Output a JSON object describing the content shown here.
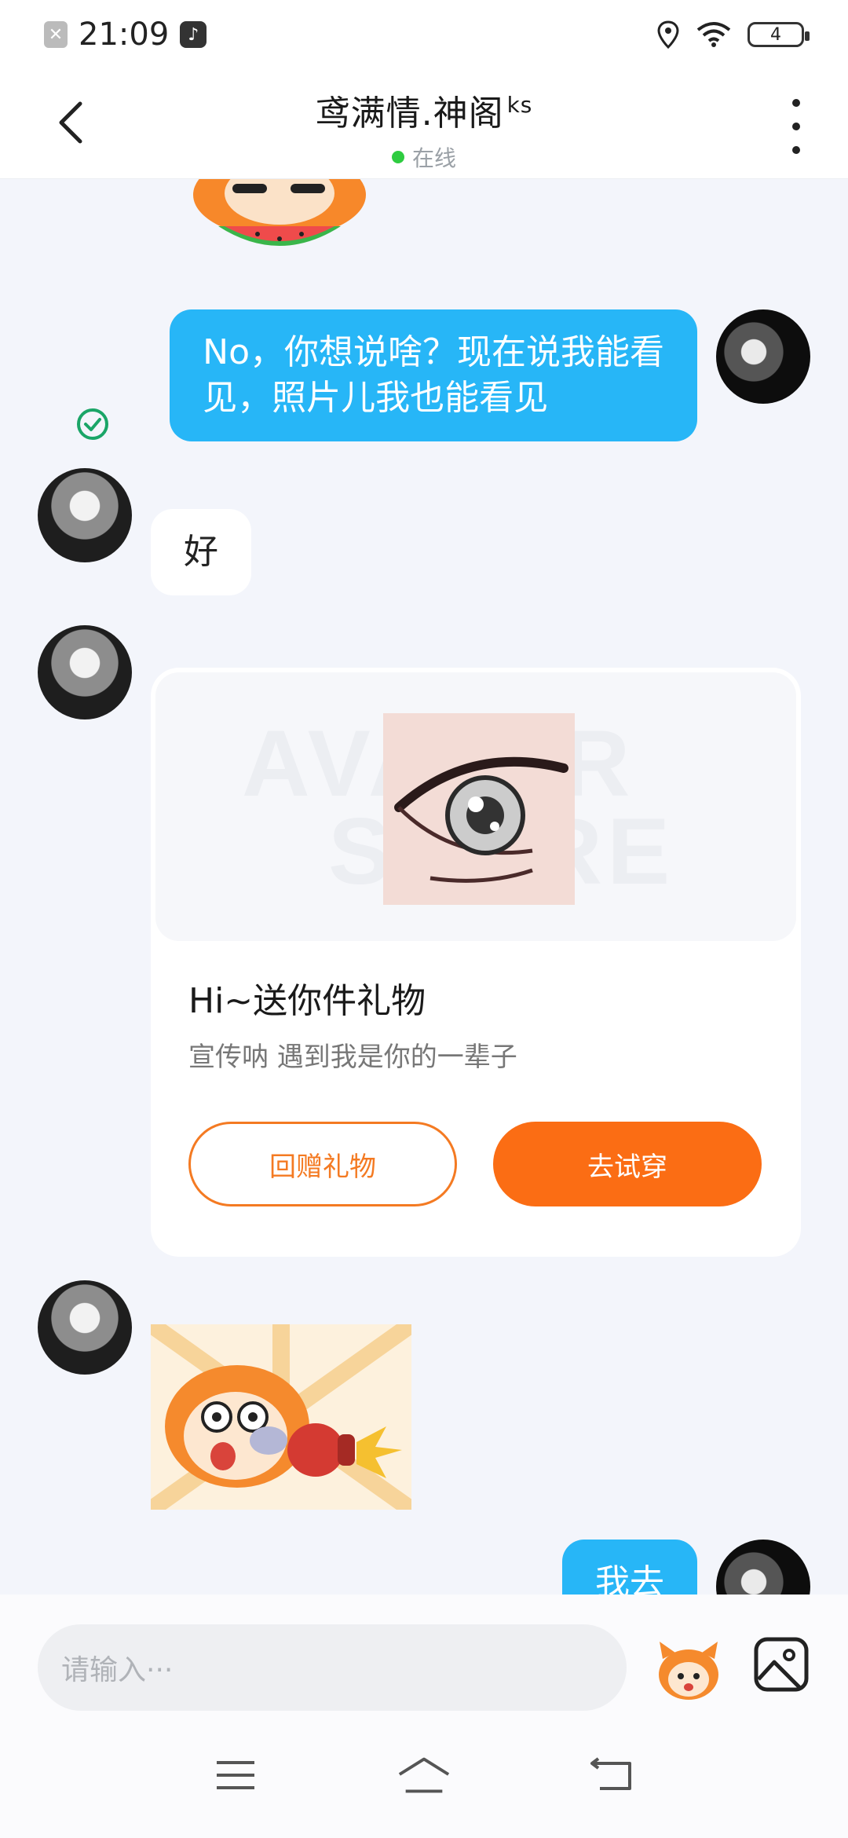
{
  "status_bar": {
    "time": "21:09",
    "battery": "4",
    "icons": [
      "notification-chip-icon",
      "tiktok-icon",
      "location-icon",
      "wifi-icon",
      "battery-icon"
    ]
  },
  "header": {
    "title": "鸢满情.神阁",
    "title_suffix": "ks",
    "status": "在线",
    "status_color": "#2ecc40"
  },
  "messages": [
    {
      "side": "right",
      "text_line1": "No，你想说啥？现在说我能看",
      "text_line2": "见，照片儿我也能看见",
      "read": true
    },
    {
      "side": "left",
      "text": "好"
    },
    {
      "side": "right",
      "text": "我去"
    }
  ],
  "gift_card": {
    "watermark_line1": "AVATAR",
    "watermark_line2": "STORE",
    "title": "Hi~送你件礼物",
    "subtitle": "宣传呐 遇到我是你的一辈子",
    "button_return": "回赠礼物",
    "button_try": "去试穿",
    "accent_color": "#fb6d14"
  },
  "input": {
    "placeholder": "请输入···"
  },
  "colors": {
    "bubble_blue": "#27b6f7",
    "background": "#f3f5fb"
  }
}
